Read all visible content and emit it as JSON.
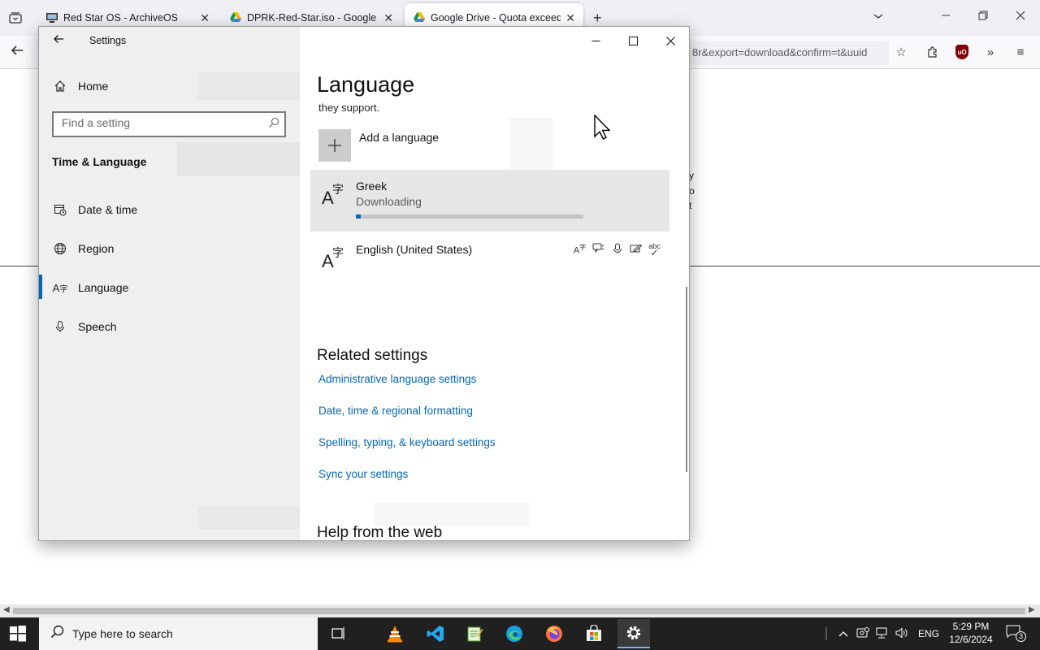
{
  "browser": {
    "tabs": [
      {
        "title": "Red Star OS - ArchiveOS",
        "active": false
      },
      {
        "title": "DPRK-Red-Star.iso - Google Dri",
        "active": false
      },
      {
        "title": "Google Drive - Quota exceeded",
        "active": true
      }
    ],
    "url_fragment": "8r&export=download&confirm=t&uuid",
    "page_fragments": [
      "y",
      "o",
      "t"
    ]
  },
  "settings": {
    "window_title": "Settings",
    "home_label": "Home",
    "search_placeholder": "Find a setting",
    "section_title": "Time & Language",
    "nav": [
      {
        "label": "Date & time",
        "icon": "calendar-clock-icon"
      },
      {
        "label": "Region",
        "icon": "globe-icon"
      },
      {
        "label": "Language",
        "icon": "language-icon",
        "selected": true
      },
      {
        "label": "Speech",
        "icon": "microphone-icon"
      }
    ],
    "page_title": "Language",
    "clipped_text": "they support.",
    "add_language_label": "Add a language",
    "languages": [
      {
        "name": "Greek",
        "status": "Downloading",
        "progress": 0.02,
        "selected": true
      },
      {
        "name": "English (United States)",
        "status": "",
        "features": [
          "language-pack-icon",
          "text-to-speech-icon",
          "speech-recognition-icon",
          "handwriting-icon",
          "spellcheck-icon"
        ]
      }
    ],
    "related_heading": "Related settings",
    "related_links": [
      "Administrative language settings",
      "Date, time & regional formatting",
      "Spelling, typing, & keyboard settings",
      "Sync your settings"
    ],
    "help_heading": "Help from the web"
  },
  "taskbar": {
    "search_placeholder": "Type here to search",
    "apps": [
      "task-view-icon",
      "vlc-icon",
      "vscode-icon",
      "notepad-icon",
      "edge-icon",
      "firefox-icon",
      "store-icon",
      "settings-icon"
    ],
    "language": "ENG",
    "time": "5:29 PM",
    "date": "12/6/2024",
    "notification_count": "3"
  },
  "colors": {
    "accent": "#0067c0",
    "taskbar": "#202020",
    "settings_sidebar": "#efefef"
  }
}
